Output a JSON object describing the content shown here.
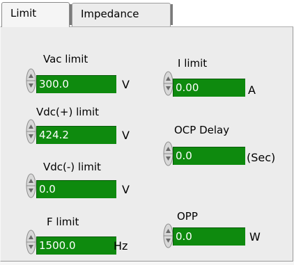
{
  "tabs": [
    {
      "label": "Limit",
      "active": true
    },
    {
      "label": "Impedance",
      "active": false
    }
  ],
  "controls": {
    "vac_limit": {
      "label": "Vac limit",
      "value": "300.0",
      "unit": "V"
    },
    "vdc_pos_limit": {
      "label": "Vdc(+) limit",
      "value": "424.2",
      "unit": "V"
    },
    "vdc_neg_limit": {
      "label": "Vdc(-) limit",
      "value": "0.0",
      "unit": "V"
    },
    "f_limit": {
      "label": "F limit",
      "value": "1500.0",
      "unit": "Hz"
    },
    "i_limit": {
      "label": "I limit",
      "value": "0.00",
      "unit": "A"
    },
    "ocp_delay": {
      "label": "OCP Delay",
      "value": "0.0",
      "unit": "(Sec)"
    },
    "opp": {
      "label": "OPP",
      "value": "0.0",
      "unit": "W"
    }
  },
  "colors": {
    "field": "#0e8a0e",
    "panel": "#ececec"
  }
}
